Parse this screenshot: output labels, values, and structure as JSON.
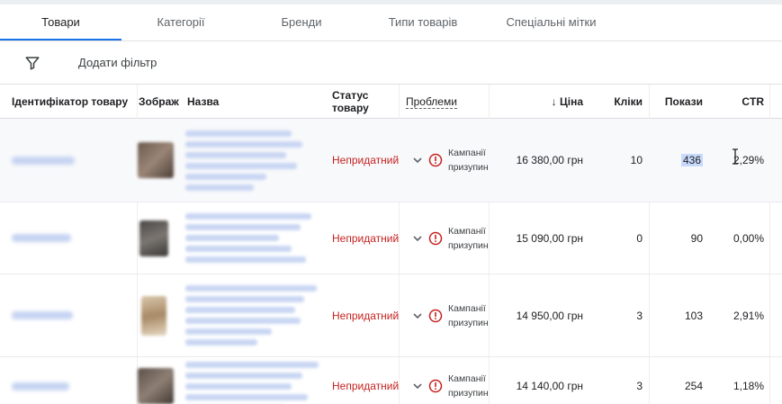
{
  "tabs": [
    {
      "label": "Товари",
      "active": true
    },
    {
      "label": "Категорії",
      "active": false
    },
    {
      "label": "Бренди",
      "active": false
    },
    {
      "label": "Типи товарів",
      "active": false
    },
    {
      "label": "Спеціальні мітки",
      "active": false
    }
  ],
  "filter_bar": {
    "icon": "filter-icon",
    "label": "Додати фільтр"
  },
  "table": {
    "headers": {
      "id": "Ідентифікатор товару",
      "image": "Зображ",
      "name": "Назва",
      "status": "Статус товару",
      "issues": "Проблеми",
      "price": "↓ Ціна",
      "clicks": "Кліки",
      "impressions": "Покази",
      "ctr": "CTR"
    },
    "rows": [
      {
        "status": "Непридатний",
        "issue": "Кампанії призупинено",
        "price": "16 380,00 грн",
        "clicks": "10",
        "impressions": "436",
        "ctr": "2,29%"
      },
      {
        "status": "Непридатний",
        "issue": "Кампанії призупинено",
        "price": "15 090,00 грн",
        "clicks": "0",
        "impressions": "90",
        "ctr": "0,00%"
      },
      {
        "status": "Непридатний",
        "issue": "Кампанії призупинено",
        "price": "14 950,00 грн",
        "clicks": "3",
        "impressions": "103",
        "ctr": "2,91%"
      },
      {
        "status": "Непридатний",
        "issue": "Кампанії призупинено",
        "price": "14 140,00 грн",
        "clicks": "3",
        "impressions": "254",
        "ctr": "1,18%"
      }
    ]
  },
  "colors": {
    "accent": "#1a73e8",
    "error": "#c5221f",
    "selection": "#c8dafb"
  }
}
